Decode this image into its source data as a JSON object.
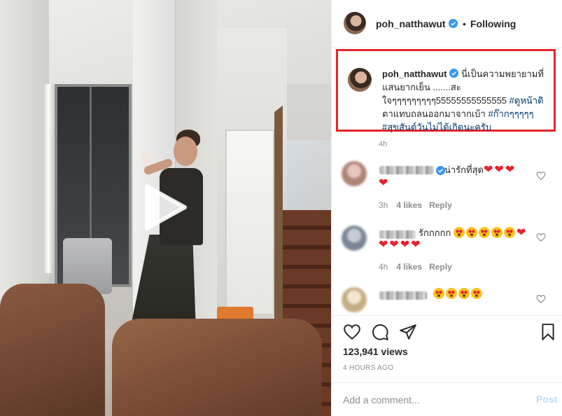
{
  "post": {
    "username": "poh_natthawut",
    "follow_status": "Following",
    "separator": "•"
  },
  "caption": {
    "username": "poh_natthawut",
    "text_before_tags": "นี่เป็นความพยายามที่แสนยากเย็น .......สะใจๆๆๆๆๆๆๆๆๆ55555555555555",
    "tag1": "#ดูหน้าดิ",
    "mid_text": "ตาแทบถลนออกมาจากเบ้า",
    "tag2": "#ก๊ากๆๆๆๆๆ",
    "tag3": "#สุขสันต์วันไม่ได้เกิดนะครับ",
    "time": "4h"
  },
  "comments": [
    {
      "text": "น่ารักที่สุด",
      "hearts": "❤❤❤",
      "hearts_line2": "❤",
      "time": "3h",
      "likes": "4 likes",
      "reply": "Reply",
      "avatar_color": "#c9a59a"
    },
    {
      "text": "รักกกกก",
      "hearts_after": "❤",
      "hearts_line2": "❤❤❤❤",
      "time": "4h",
      "likes": "4 likes",
      "reply": "Reply",
      "avatar_color": "#9aa3b0"
    },
    {
      "text": "",
      "avatar_color": "#d7c7a5"
    }
  ],
  "stats": {
    "views": "123,941 views",
    "posted": "4 HOURS AGO"
  },
  "add_comment": {
    "placeholder": "Add a comment...",
    "post_label": "Post"
  },
  "icons": {
    "verified": "verified-badge-icon",
    "like": "heart-icon",
    "comment": "comment-icon",
    "share": "share-icon",
    "save": "bookmark-icon",
    "play": "play-icon"
  },
  "colors": {
    "highlight_border": "#e8232a",
    "hashtag": "#00376b",
    "verified": "#3897f0",
    "post_disabled": "#b2dffc"
  }
}
